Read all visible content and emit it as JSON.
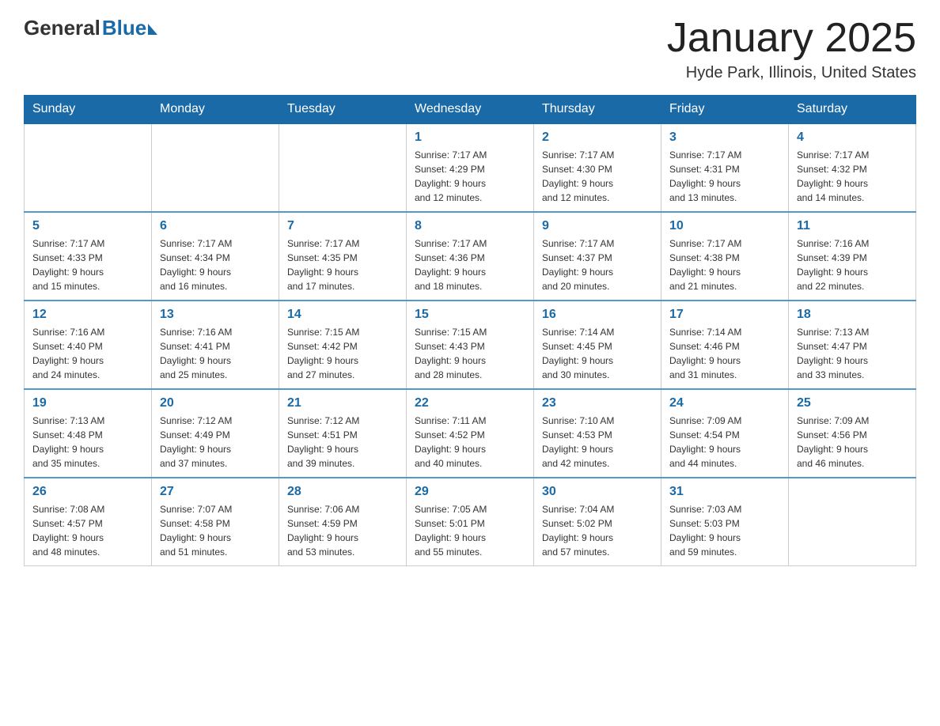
{
  "header": {
    "logo_general": "General",
    "logo_blue": "Blue",
    "title": "January 2025",
    "subtitle": "Hyde Park, Illinois, United States"
  },
  "days_of_week": [
    "Sunday",
    "Monday",
    "Tuesday",
    "Wednesday",
    "Thursday",
    "Friday",
    "Saturday"
  ],
  "weeks": [
    [
      {
        "day": "",
        "info": ""
      },
      {
        "day": "",
        "info": ""
      },
      {
        "day": "",
        "info": ""
      },
      {
        "day": "1",
        "info": "Sunrise: 7:17 AM\nSunset: 4:29 PM\nDaylight: 9 hours\nand 12 minutes."
      },
      {
        "day": "2",
        "info": "Sunrise: 7:17 AM\nSunset: 4:30 PM\nDaylight: 9 hours\nand 12 minutes."
      },
      {
        "day": "3",
        "info": "Sunrise: 7:17 AM\nSunset: 4:31 PM\nDaylight: 9 hours\nand 13 minutes."
      },
      {
        "day": "4",
        "info": "Sunrise: 7:17 AM\nSunset: 4:32 PM\nDaylight: 9 hours\nand 14 minutes."
      }
    ],
    [
      {
        "day": "5",
        "info": "Sunrise: 7:17 AM\nSunset: 4:33 PM\nDaylight: 9 hours\nand 15 minutes."
      },
      {
        "day": "6",
        "info": "Sunrise: 7:17 AM\nSunset: 4:34 PM\nDaylight: 9 hours\nand 16 minutes."
      },
      {
        "day": "7",
        "info": "Sunrise: 7:17 AM\nSunset: 4:35 PM\nDaylight: 9 hours\nand 17 minutes."
      },
      {
        "day": "8",
        "info": "Sunrise: 7:17 AM\nSunset: 4:36 PM\nDaylight: 9 hours\nand 18 minutes."
      },
      {
        "day": "9",
        "info": "Sunrise: 7:17 AM\nSunset: 4:37 PM\nDaylight: 9 hours\nand 20 minutes."
      },
      {
        "day": "10",
        "info": "Sunrise: 7:17 AM\nSunset: 4:38 PM\nDaylight: 9 hours\nand 21 minutes."
      },
      {
        "day": "11",
        "info": "Sunrise: 7:16 AM\nSunset: 4:39 PM\nDaylight: 9 hours\nand 22 minutes."
      }
    ],
    [
      {
        "day": "12",
        "info": "Sunrise: 7:16 AM\nSunset: 4:40 PM\nDaylight: 9 hours\nand 24 minutes."
      },
      {
        "day": "13",
        "info": "Sunrise: 7:16 AM\nSunset: 4:41 PM\nDaylight: 9 hours\nand 25 minutes."
      },
      {
        "day": "14",
        "info": "Sunrise: 7:15 AM\nSunset: 4:42 PM\nDaylight: 9 hours\nand 27 minutes."
      },
      {
        "day": "15",
        "info": "Sunrise: 7:15 AM\nSunset: 4:43 PM\nDaylight: 9 hours\nand 28 minutes."
      },
      {
        "day": "16",
        "info": "Sunrise: 7:14 AM\nSunset: 4:45 PM\nDaylight: 9 hours\nand 30 minutes."
      },
      {
        "day": "17",
        "info": "Sunrise: 7:14 AM\nSunset: 4:46 PM\nDaylight: 9 hours\nand 31 minutes."
      },
      {
        "day": "18",
        "info": "Sunrise: 7:13 AM\nSunset: 4:47 PM\nDaylight: 9 hours\nand 33 minutes."
      }
    ],
    [
      {
        "day": "19",
        "info": "Sunrise: 7:13 AM\nSunset: 4:48 PM\nDaylight: 9 hours\nand 35 minutes."
      },
      {
        "day": "20",
        "info": "Sunrise: 7:12 AM\nSunset: 4:49 PM\nDaylight: 9 hours\nand 37 minutes."
      },
      {
        "day": "21",
        "info": "Sunrise: 7:12 AM\nSunset: 4:51 PM\nDaylight: 9 hours\nand 39 minutes."
      },
      {
        "day": "22",
        "info": "Sunrise: 7:11 AM\nSunset: 4:52 PM\nDaylight: 9 hours\nand 40 minutes."
      },
      {
        "day": "23",
        "info": "Sunrise: 7:10 AM\nSunset: 4:53 PM\nDaylight: 9 hours\nand 42 minutes."
      },
      {
        "day": "24",
        "info": "Sunrise: 7:09 AM\nSunset: 4:54 PM\nDaylight: 9 hours\nand 44 minutes."
      },
      {
        "day": "25",
        "info": "Sunrise: 7:09 AM\nSunset: 4:56 PM\nDaylight: 9 hours\nand 46 minutes."
      }
    ],
    [
      {
        "day": "26",
        "info": "Sunrise: 7:08 AM\nSunset: 4:57 PM\nDaylight: 9 hours\nand 48 minutes."
      },
      {
        "day": "27",
        "info": "Sunrise: 7:07 AM\nSunset: 4:58 PM\nDaylight: 9 hours\nand 51 minutes."
      },
      {
        "day": "28",
        "info": "Sunrise: 7:06 AM\nSunset: 4:59 PM\nDaylight: 9 hours\nand 53 minutes."
      },
      {
        "day": "29",
        "info": "Sunrise: 7:05 AM\nSunset: 5:01 PM\nDaylight: 9 hours\nand 55 minutes."
      },
      {
        "day": "30",
        "info": "Sunrise: 7:04 AM\nSunset: 5:02 PM\nDaylight: 9 hours\nand 57 minutes."
      },
      {
        "day": "31",
        "info": "Sunrise: 7:03 AM\nSunset: 5:03 PM\nDaylight: 9 hours\nand 59 minutes."
      },
      {
        "day": "",
        "info": ""
      }
    ]
  ]
}
